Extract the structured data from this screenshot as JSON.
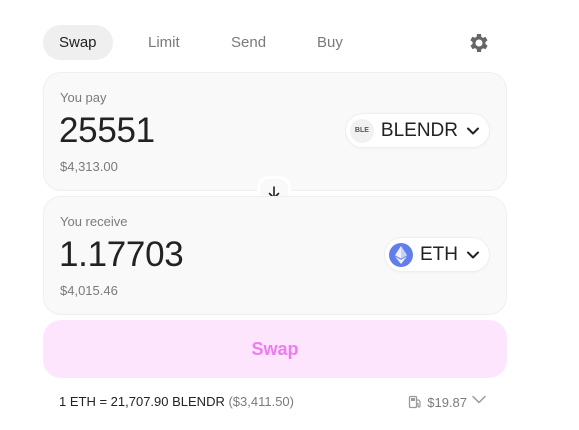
{
  "tabs": [
    {
      "label": "Swap"
    },
    {
      "label": "Limit"
    },
    {
      "label": "Send"
    },
    {
      "label": "Buy"
    }
  ],
  "settings_icon": "gear-icon",
  "pay": {
    "label": "You pay",
    "amount": "25551",
    "usd": "$4,313.00",
    "token": {
      "logo_text": "BLE",
      "symbol": "BLENDR"
    }
  },
  "receive": {
    "label": "You receive",
    "amount": "1.17703",
    "usd": "$4,015.46",
    "token": {
      "symbol": "ETH"
    }
  },
  "swap_button": {
    "label": "Swap"
  },
  "rate": {
    "text": "1 ETH = 21,707.90 BLENDR",
    "usd": "($3,411.50)"
  },
  "gas": {
    "value": "$19.87",
    "icon": "gas-pump-icon"
  },
  "colors": {
    "accent": "#f07bf0",
    "accent_bg": "#fde6fd",
    "eth": "#627eea"
  }
}
